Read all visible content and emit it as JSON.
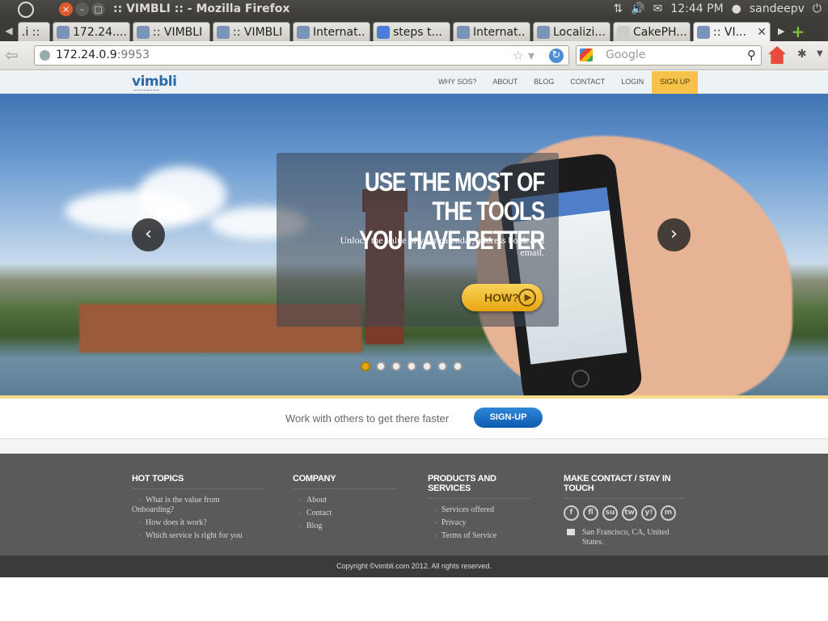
{
  "window": {
    "title": ":: VIMBLI :: - Mozilla Firefox",
    "clock": "12:44 PM",
    "user": "sandeepv"
  },
  "tabs": [
    {
      "label": ".i ::"
    },
    {
      "label": "172.24...."
    },
    {
      "label": ":: VIMBLI ::"
    },
    {
      "label": ":: VIMBLI ::"
    },
    {
      "label": "Internat..."
    },
    {
      "label": "steps t..."
    },
    {
      "label": "Internat..."
    },
    {
      "label": "Localizi..."
    },
    {
      "label": "CakePH..."
    },
    {
      "label": ":: VI..."
    }
  ],
  "navbar": {
    "url_host": "172.24.0.9",
    "url_port": ":9953",
    "search_placeholder": "Google"
  },
  "site": {
    "logo": "vimbli",
    "nav": [
      "WHY SOS?",
      "ABOUT",
      "BLOG",
      "CONTACT",
      "LOGIN",
      "SIGN UP"
    ],
    "hero": {
      "title_line1": "USE THE MOST OF THE TOOLS",
      "title_line2": "YOU HAVE BETTER",
      "subtitle": "Unlock the value of your calendar, address book and email.",
      "cta": "HOW?",
      "slide_count": 7,
      "active_slide": 1
    },
    "band": {
      "text": "Work with others to get there faster",
      "button": "SIGN-UP"
    },
    "footer": {
      "hot_topics": {
        "title": "HOT TOPICS",
        "items": [
          "What is the value from Onboarding?",
          "How does it work?",
          "Which service is right for you"
        ]
      },
      "company": {
        "title": "COMPANY",
        "items": [
          "About",
          "Contact",
          "Blog"
        ]
      },
      "products": {
        "title": "PRODUCTS AND SERVICES",
        "items": [
          "Services offered",
          "Privacy",
          "Terms of Service"
        ]
      },
      "contact": {
        "title": "MAKE CONTACT / STAY IN TOUCH",
        "social": [
          "f",
          "fl",
          "su",
          "tw",
          "y!",
          "m"
        ],
        "address": "San Francisco, CA, United States."
      },
      "copyright": "Copyright ©vimbli.com 2012. All rights reserved."
    }
  },
  "colors": {
    "accent": "#f6c24a",
    "brand": "#2b6aa8",
    "footer_bg": "#5a5a5a",
    "cta_blue": "#0d5cb0"
  }
}
